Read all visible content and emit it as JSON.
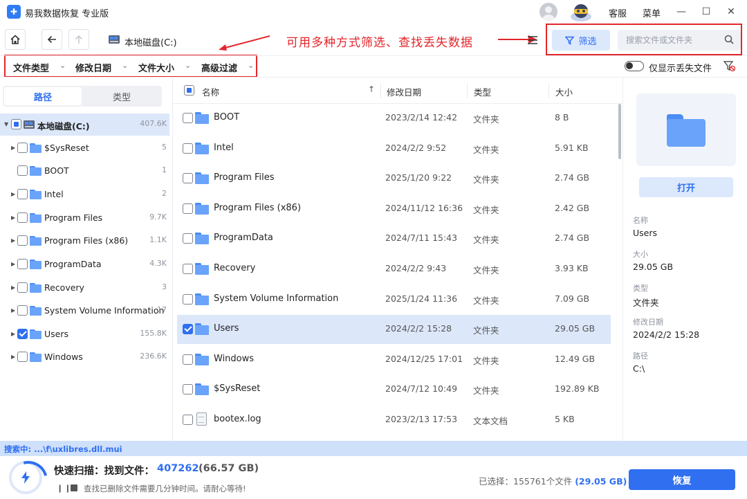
{
  "app": {
    "title": "易我数据恢复 专业版"
  },
  "titlebar": {
    "service_label": "客服",
    "menu_label": "菜单",
    "minimize": "—",
    "maximize": "☐",
    "close": "✕"
  },
  "toolbar": {
    "drive_label": "本地磁盘(C:)",
    "annotation": "可用多种方式筛选、查找丢失数据",
    "filter_label": "筛选",
    "search_placeholder": "搜索文件或文件夹"
  },
  "filters": {
    "items": [
      "文件类型",
      "修改日期",
      "文件大小",
      "高级过滤"
    ],
    "toggle_label": "仅显示丢失文件"
  },
  "left": {
    "tabs": [
      "路径",
      "类型"
    ],
    "root": {
      "label": "本地磁盘(C:)",
      "count": "407.6K"
    },
    "items": [
      {
        "label": "$SysReset",
        "count": "5"
      },
      {
        "label": "BOOT",
        "count": "1"
      },
      {
        "label": "Intel",
        "count": "2"
      },
      {
        "label": "Program Files",
        "count": "9.7K"
      },
      {
        "label": "Program Files (x86)",
        "count": "1.1K"
      },
      {
        "label": "ProgramData",
        "count": "4.3K"
      },
      {
        "label": "Recovery",
        "count": "3"
      },
      {
        "label": "System Volume Information",
        "count": "17"
      },
      {
        "label": "Users",
        "count": "155.8K"
      },
      {
        "label": "Windows",
        "count": "236.6K"
      }
    ]
  },
  "list": {
    "headers": {
      "name": "名称",
      "date": "修改日期",
      "type": "类型",
      "size": "大小"
    },
    "rows": [
      {
        "name": "BOOT",
        "date": "2023/2/14 12:42",
        "type": "文件夹",
        "size": "8 B"
      },
      {
        "name": "Intel",
        "date": "2024/2/2 9:52",
        "type": "文件夹",
        "size": "5.91 KB"
      },
      {
        "name": "Program Files",
        "date": "2025/1/20 9:22",
        "type": "文件夹",
        "size": "2.74 GB"
      },
      {
        "name": "Program Files (x86)",
        "date": "2024/11/12 16:36",
        "type": "文件夹",
        "size": "2.42 GB"
      },
      {
        "name": "ProgramData",
        "date": "2024/7/11 15:43",
        "type": "文件夹",
        "size": "2.74 GB"
      },
      {
        "name": "Recovery",
        "date": "2024/2/2 9:43",
        "type": "文件夹",
        "size": "3.93 KB"
      },
      {
        "name": "System Volume Information",
        "date": "2025/1/24 11:36",
        "type": "文件夹",
        "size": "7.09 GB"
      },
      {
        "name": "Users",
        "date": "2024/2/2 15:28",
        "type": "文件夹",
        "size": "29.05 GB"
      },
      {
        "name": "Windows",
        "date": "2024/12/25 17:01",
        "type": "文件夹",
        "size": "12.49 GB"
      },
      {
        "name": "$SysReset",
        "date": "2024/7/12 10:49",
        "type": "文件夹",
        "size": "192.89 KB"
      },
      {
        "name": "bootex.log",
        "date": "2023/2/13 17:53",
        "type": "文本文档",
        "size": "5 KB"
      }
    ]
  },
  "details": {
    "open_label": "打开",
    "name_key": "名称",
    "name_val": "Users",
    "size_key": "大小",
    "size_val": "29.05 GB",
    "type_key": "类型",
    "type_val": "文件夹",
    "date_key": "修改日期",
    "date_val": "2024/2/2 15:28",
    "path_key": "路径",
    "path_val": "C:\\"
  },
  "status": {
    "text": "搜索中:   ...\\f\\uxlibres.dll.mui"
  },
  "bottom": {
    "scan_title": "快速扫描：找到文件：",
    "scan_count": "407262",
    "scan_size": "(66.57 GB)",
    "hint": "查找已删除文件需要几分钟时间。请耐心等待!",
    "selected_prefix": "已选择：155761个文件 ",
    "selected_size": "(29.05 GB)",
    "recover_label": "恢复"
  }
}
